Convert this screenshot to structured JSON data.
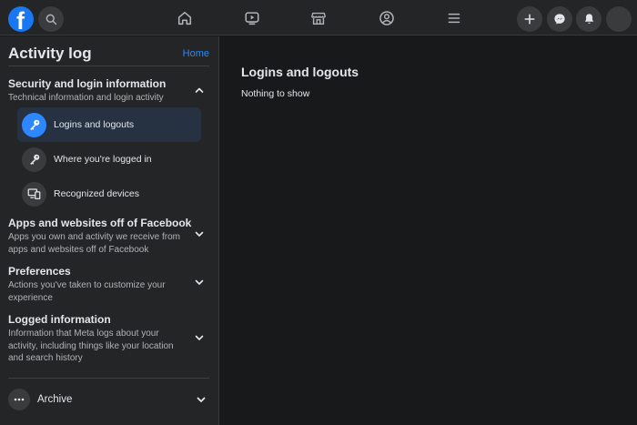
{
  "nav": {
    "logo_icon": "facebook-logo",
    "icons": [
      "search-icon",
      "home-icon",
      "watch-icon",
      "marketplace-icon",
      "groups-icon",
      "menu-icon",
      "create-icon",
      "messenger-icon",
      "notifications-icon"
    ]
  },
  "sidebar": {
    "title": "Activity log",
    "home_link": "Home",
    "sections": [
      {
        "title": "Security and login information",
        "subtitle": "Technical information and login activity",
        "expanded": true,
        "items": [
          {
            "label": "Logins and logouts",
            "icon": "key-icon",
            "active": true
          },
          {
            "label": "Where you're logged in",
            "icon": "key-icon",
            "active": false
          },
          {
            "label": "Recognized devices",
            "icon": "devices-icon",
            "active": false
          }
        ]
      },
      {
        "title": "Apps and websites off of Facebook",
        "subtitle": "Apps you own and activity we receive from apps and websites off of Facebook",
        "expanded": false
      },
      {
        "title": "Preferences",
        "subtitle": "Actions you've taken to customize your experience",
        "expanded": false
      },
      {
        "title": "Logged information",
        "subtitle": "Information that Meta logs about your activity, including things like your location and search history",
        "expanded": false
      }
    ],
    "archive": {
      "label": "Archive",
      "icon": "more-dots-icon"
    }
  },
  "main": {
    "title": "Logins and logouts",
    "empty_text": "Nothing to show"
  },
  "colors": {
    "accent": "#2d88ff",
    "brand": "#1877f2",
    "background": "#18191a",
    "surface": "#242526"
  }
}
